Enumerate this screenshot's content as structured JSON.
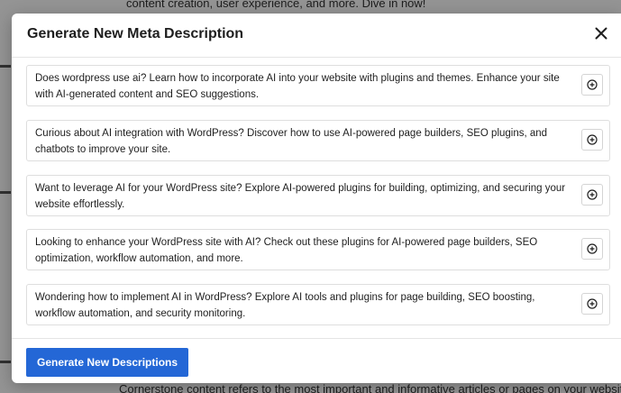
{
  "background": {
    "top_text": "content creation, user experience, and more. Dive in now!",
    "bottom_text": "Cornerstone content refers to the most important and informative articles or pages on your website"
  },
  "modal": {
    "title": "Generate New Meta Description",
    "close_icon": "close-icon",
    "descriptions": [
      {
        "text": "Does wordpress use ai? Learn how to incorporate AI into your website with plugins and themes. Enhance your site with AI-generated content and SEO suggestions."
      },
      {
        "text": "Curious about AI integration with WordPress? Discover how to use AI-powered page builders, SEO plugins, and chatbots to improve your site."
      },
      {
        "text": "Want to leverage AI for your WordPress site? Explore AI-powered plugins for building, optimizing, and securing your website effortlessly."
      },
      {
        "text": "Looking to enhance your WordPress site with AI? Check out these plugins for AI-powered page builders, SEO optimization, workflow automation, and more."
      },
      {
        "text": "Wondering how to implement AI in WordPress? Explore AI tools and plugins for page building, SEO boosting, workflow automation, and security monitoring."
      }
    ],
    "add_icon": "plus-circle-icon",
    "generate_button_label": "Generate New Descriptions"
  },
  "colors": {
    "primary": "#2467d6",
    "overlay": "rgba(0,0,0,0.42)"
  }
}
